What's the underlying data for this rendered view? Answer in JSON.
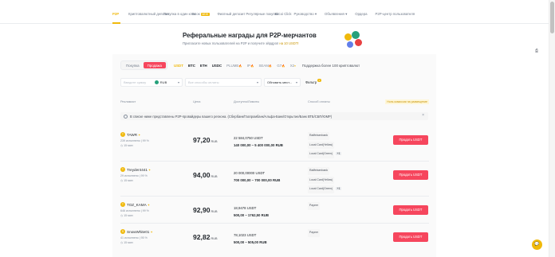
{
  "nav": {
    "items": [
      {
        "label": "P2P",
        "active": true
      },
      {
        "label": "Криптовалютный депозит"
      },
      {
        "label": "Покупка в один клик"
      },
      {
        "label": "Блок",
        "badge": "NEW"
      },
      {
        "label": "Фиатный депозит"
      },
      {
        "label": "Регулярные покупки"
      },
      {
        "label": "Bitcoi Click"
      },
      {
        "label": "Руководство"
      },
      {
        "label": "Объявления"
      },
      {
        "label": "Ордера"
      },
      {
        "label": "P2P-центр пользователя"
      }
    ]
  },
  "banner": {
    "title": "Реферальные награды для P2P-мерчантов",
    "subtitle_prefix": "Пригласите новых пользователей на P2P и получите эйрдроп ",
    "subtitle_link": "на 10 USDT!"
  },
  "trade_toggle": {
    "buy": "Покупка",
    "sell": "Продажа"
  },
  "coins": [
    {
      "label": "USDT",
      "active": true
    },
    {
      "label": "BTC"
    },
    {
      "label": "ETH"
    },
    {
      "label": "USDC"
    },
    {
      "label": "PLUME",
      "hot": "🔥"
    },
    {
      "label": "IP",
      "hot": "🔥"
    },
    {
      "label": "SEAM",
      "hot": "🔥"
    },
    {
      "label": "G7",
      "hot": "🔥"
    },
    {
      "label": "X2",
      "hot": "▾"
    }
  ],
  "promo_text": "Поддержка более 100 криптовалют",
  "filters": {
    "amount_placeholder": "Введите сумму",
    "currency": "RUB",
    "payment_placeholder": "Все способы оплаты",
    "refresh": "Обновить мест...",
    "filter_label": "Фильтр",
    "filter_count": "1"
  },
  "table_header": {
    "advertiser": "Рекламист",
    "price": "Цена",
    "available": "Доступно/Лимиты",
    "payment": "Способ оплаты",
    "fee": "Ноль комиссии на размещение"
  },
  "notice": "В списке ниже представлены P2P-провайдеры вашего региона. (Сбербанк/Газпромбанк/Альфа-Банк/Открытие/Банк ВТБ/СБП/ЮMP)",
  "rows": [
    {
      "name": "TAWR",
      "avatar": "T",
      "stats": "239 исполнено  |  99 %",
      "time": "15 мин",
      "price": "97,20",
      "currency": "RUB",
      "available": "22 584,0750 USDT",
      "limit": "140 000,00 – 5 400 000,00 RUB",
      "payments": [
        "Raiffeisenbank",
        "Local Card(Yellow)",
        "Local Card(Green)"
      ],
      "more": "+1",
      "button": "Продать USDT"
    },
    {
      "name": "Treyder4441",
      "avatar": "T",
      "stats": "29 исполнено  |  99 %",
      "time": "15 мин",
      "price": "94,00",
      "currency": "RUB",
      "available": "20 000,00000 USDT",
      "limit": "700 000,00 – 700 000,00 RUB",
      "payments": [
        "Raiffeisenbank",
        "Local Card(Yellow)",
        "Local Card(Green)"
      ],
      "more": "+1",
      "button": "Продать USDT"
    },
    {
      "name": "TOZ_KAMA",
      "avatar": "T",
      "stats": "646 исполнено  |  99 %",
      "time": "15 мин",
      "price": "92,90",
      "currency": "RUB",
      "available": "18,9478 USDT",
      "limit": "500,00 – 1762,50 RUB",
      "payments": [
        "Payeer"
      ],
      "more": "",
      "button": "Продать USDT"
    },
    {
      "name": "SnowWhite01",
      "avatar": "S",
      "stats": "41 исполнено  |  95 %",
      "time": "15 мин",
      "price": "92,82",
      "currency": "RUB",
      "available": "78,1023 USDT",
      "limit": "500,00 – 505,00 RUB",
      "payments": [
        "Payeer"
      ],
      "more": "",
      "button": "Продать USDT"
    }
  ],
  "colors": {
    "accent": "#f0b90b",
    "sell": "#f6465d",
    "text": "#1e2329",
    "muted": "#848e9c"
  }
}
